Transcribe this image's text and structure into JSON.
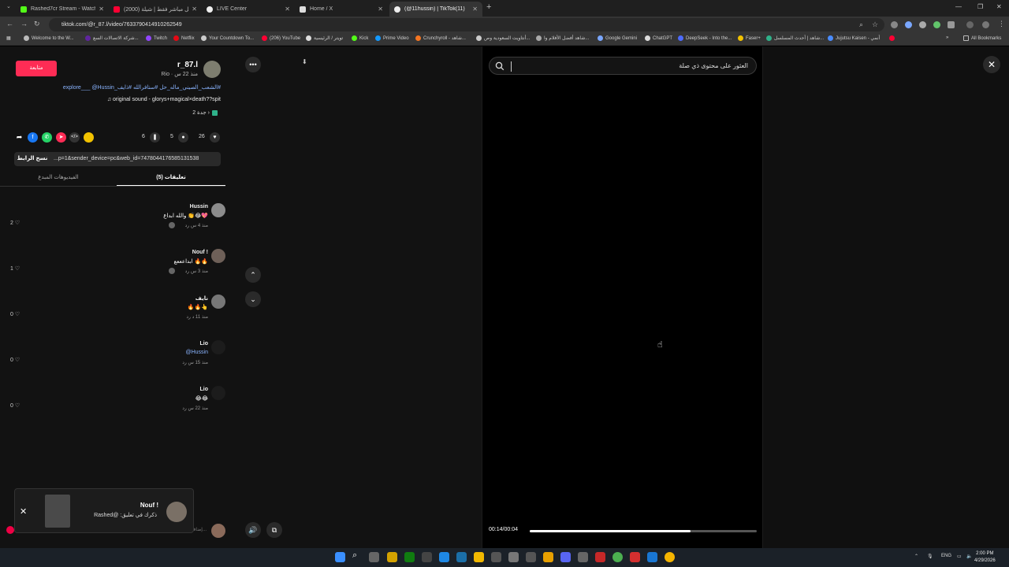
{
  "browser": {
    "tabs": [
      {
        "label": "Rashed7cr Stream - Watch Live",
        "color": "#53fc18"
      },
      {
        "label": "(2000) تحويل مباشر فقط | شيلة",
        "color": "#ff0033"
      },
      {
        "label": "LIVE Center",
        "color": "#ffffff"
      },
      {
        "label": "Home / X",
        "color": "#ffffff"
      },
      {
        "label": "(@11hussin) | TikTok(11)",
        "color": "#ffffff"
      }
    ],
    "new_tab": "+",
    "url": "tiktok.com/@r_87.l/video/7633790414910262549",
    "bookmarks": [
      "Welcome to the W...",
      "شركة الاتصالات السع...",
      "Twitch",
      "Netflix",
      "Your Countdown To...",
      "(206) YouTube",
      "تويتر / الرئيسية",
      "Kick",
      "Prime Video",
      "Crunchyroll - شاهد...",
      "أنتاويت السعودية وص...",
      "شاهد أفضل الأفلام وا...",
      "Google Gemini",
      "ChatGPT",
      "DeepSeek - Into the...",
      "Faser+",
      "شاهد | أحدث المسلسل...",
      "Jujutsu Kaisen - أنمي",
      "All Bookmarks"
    ]
  },
  "video": {
    "author": "r_87.l",
    "author_meta": "Rio · منذ 22 س",
    "follow_label": "متابعة",
    "caption": "#الشعب_الصيني_ماله_حل #ستافرالله #ذايف_explore___ @Hussin",
    "sound": "♫ original sound - glorys+magical×death??spit",
    "effect": "جدة 2 ›",
    "counts": {
      "likes": "26",
      "comments": "5",
      "saves": "6"
    },
    "copy_link_label": "نسخ الرابط",
    "link_text": "...p=1&sender_device=pc&web_id=7478044176585131538",
    "tab_videos": "الفيديوهات المبدع",
    "tab_comments": "تعليقات (5)"
  },
  "comments": [
    {
      "name": "Hussin",
      "text": "والله ابداع 👏😂💖",
      "meta": "منذ 4 س   رد",
      "likes": "2",
      "avatar": "#8c8c8c"
    },
    {
      "name": "Nouf !",
      "text": "ابداعععع 🔥🔥",
      "meta": "منذ 3 س   رد",
      "likes": "1",
      "avatar": "#6e6058"
    },
    {
      "name": "نايف",
      "text": "🔥🔥👆",
      "meta": "منذ 11 د   رد",
      "likes": "0",
      "avatar": "#777777"
    },
    {
      "name": "Lio",
      "text": "@Hussin",
      "meta": "منذ 15 س   رد",
      "likes": "0",
      "avatar": "#1c1c1c"
    },
    {
      "name": "Lio",
      "text": "😂😂",
      "meta": "منذ 22 س   رد",
      "likes": "0",
      "avatar": "#1c1c1c"
    }
  ],
  "toast": {
    "title": "Nouf !",
    "text": "ذكرك في تعليق: @Rashed"
  },
  "reply_placeholder": "إضافة تعليق...",
  "search": {
    "placeholder": "العثور على محتوى ذي صلة"
  },
  "player": {
    "time": "00:14/00:04",
    "progress": 0.71
  },
  "taskbar": {
    "lang": "ENG",
    "time": "2:00 PM",
    "date": "4/29/2026"
  }
}
